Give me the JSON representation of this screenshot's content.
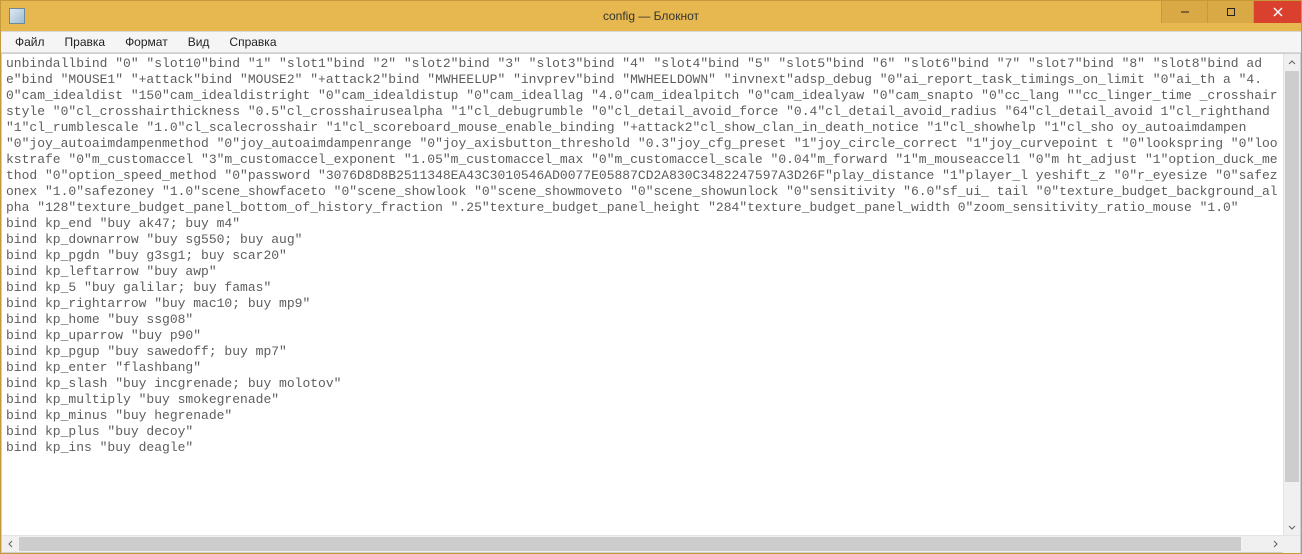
{
  "window": {
    "title": "config — Блокнот"
  },
  "menu": {
    "file": "Файл",
    "edit": "Правка",
    "format": "Формат",
    "view": "Вид",
    "help": "Справка"
  },
  "content": "unbindallbind \"0\" \"slot10\"bind \"1\" \"slot1\"bind \"2\" \"slot2\"bind \"3\" \"slot3\"bind \"4\" \"slot4\"bind \"5\" \"slot5\"bind \"6\" \"slot6\"bind \"7\" \"slot7\"bind \"8\" \"slot8\"bind ade\"bind \"MOUSE1\" \"+attack\"bind \"MOUSE2\" \"+attack2\"bind \"MWHEELUP\" \"invprev\"bind \"MWHEELDOWN\" \"invnext\"adsp_debug \"0\"ai_report_task_timings_on_limit \"0\"ai_th a \"4.0\"cam_idealdist \"150\"cam_idealdistright \"0\"cam_idealdistup \"0\"cam_ideallag \"4.0\"cam_idealpitch \"0\"cam_idealyaw \"0\"cam_snapto \"0\"cc_lang \"\"cc_linger_time _crosshairstyle \"0\"cl_crosshairthickness \"0.5\"cl_crosshairusealpha \"1\"cl_debugrumble \"0\"cl_detail_avoid_force \"0.4\"cl_detail_avoid_radius \"64\"cl_detail_avoid 1\"cl_righthand \"1\"cl_rumblescale \"1.0\"cl_scalecrosshair \"1\"cl_scoreboard_mouse_enable_binding \"+attack2\"cl_show_clan_in_death_notice \"1\"cl_showhelp \"1\"cl_sho oy_autoaimdampen \"0\"joy_autoaimdampenmethod \"0\"joy_autoaimdampenrange \"0\"joy_axisbutton_threshold \"0.3\"joy_cfg_preset \"1\"joy_circle_correct \"1\"joy_curvepoint t \"0\"lookspring \"0\"lookstrafe \"0\"m_customaccel \"3\"m_customaccel_exponent \"1.05\"m_customaccel_max \"0\"m_customaccel_scale \"0.04\"m_forward \"1\"m_mouseaccel1 \"0\"m ht_adjust \"1\"option_duck_method \"0\"option_speed_method \"0\"password \"3076D8D8B2511348EA43C3010546AD0077E05887CD2A830C3482247597A3D26F\"play_distance \"1\"player_l yeshift_z \"0\"r_eyesize \"0\"safezonex \"1.0\"safezoney \"1.0\"scene_showfaceto \"0\"scene_showlook \"0\"scene_showmoveto \"0\"scene_showunlock \"0\"sensitivity \"6.0\"sf_ui_ tail \"0\"texture_budget_background_alpha \"128\"texture_budget_panel_bottom_of_history_fraction \".25\"texture_budget_panel_height \"284\"texture_budget_panel_width 0\"zoom_sensitivity_ratio_mouse \"1.0\"\nbind kp_end \"buy ak47; buy m4\"\nbind kp_downarrow \"buy sg550; buy aug\"\nbind kp_pgdn \"buy g3sg1; buy scar20\"\nbind kp_leftarrow \"buy awp\"\nbind kp_5 \"buy galilar; buy famas\"\nbind kp_rightarrow \"buy mac10; buy mp9\"\nbind kp_home \"buy ssg08\"\nbind kp_uparrow \"buy p90\"\nbind kp_pgup \"buy sawedoff; buy mp7\"\nbind kp_enter \"flashbang\"\nbind kp_slash \"buy incgrenade; buy molotov\"\nbind kp_multiply \"buy smokegrenade\"\nbind kp_minus \"buy hegrenade\"\nbind kp_plus \"buy decoy\"\nbind kp_ins \"buy deagle\""
}
